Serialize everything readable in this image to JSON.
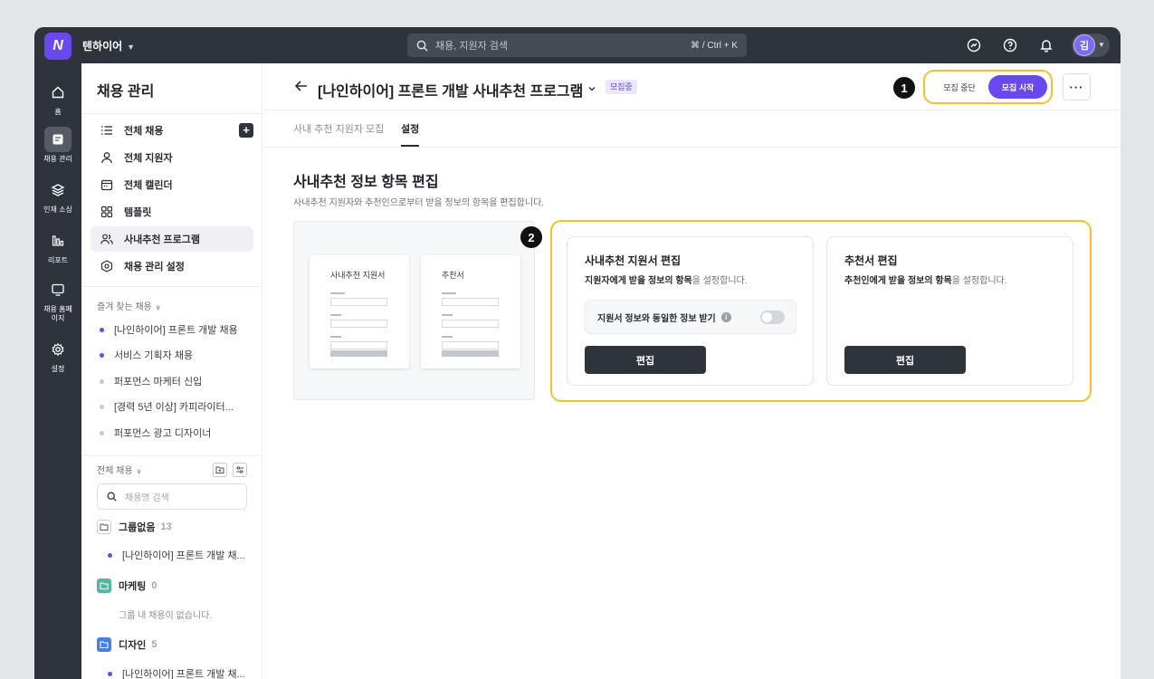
{
  "topbar": {
    "logo_letter": "N",
    "workspace": "텐하이어",
    "search_placeholder": "채용, 지원자 검색",
    "search_shortcut": "⌘ / Ctrl + K",
    "avatar_initial": "김"
  },
  "rail": {
    "items": [
      {
        "label": "홈"
      },
      {
        "label": "채용 관리"
      },
      {
        "label": "인재 소싱"
      },
      {
        "label": "리포트"
      },
      {
        "label": "채용 홈페이지"
      },
      {
        "label": "설정"
      }
    ]
  },
  "sidebar": {
    "title": "채용 관리",
    "nav": [
      {
        "label": "전체 채용"
      },
      {
        "label": "전체 지원자"
      },
      {
        "label": "전체 캘린더"
      },
      {
        "label": "템플릿"
      },
      {
        "label": "사내추천 프로그램"
      },
      {
        "label": "채용 관리 설정"
      }
    ],
    "favorites_title": "즐겨 찾는 채용",
    "favorites": [
      {
        "label": "[나인하이어] 프론트 개발 채용",
        "active": true
      },
      {
        "label": "서비스 기획자 채용",
        "active": true
      },
      {
        "label": "퍼포먼스 마케터 신입",
        "active": false
      },
      {
        "label": "[경력 5년 이상] 카피라이터...",
        "active": false
      },
      {
        "label": "퍼포먼스 광고 디자이너",
        "active": false
      }
    ],
    "all_title": "전체 채용",
    "search_placeholder": "채용명 검색",
    "groups": [
      {
        "name": "그룹없음",
        "count": "13",
        "item": "[나인하이어] 프론트 개발 채..."
      },
      {
        "name": "마케팅",
        "count": "0",
        "empty": "그룹 내 채용이 없습니다."
      },
      {
        "name": "디자인",
        "count": "5",
        "item": "[나인하이어] 프론트 개발 채..."
      }
    ]
  },
  "header": {
    "title": "[나인하이어] 프론트 개발 사내추천 프로그램",
    "badge": "모집중",
    "step1": "1",
    "stop_label": "모집 중단",
    "start_label": "모집 시작",
    "more_label": "···"
  },
  "tabs": [
    {
      "label": "사내 추천 지원자 모집"
    },
    {
      "label": "설정"
    }
  ],
  "section": {
    "title": "사내추천 정보 항목 편집",
    "desc": "사내추천 지원자와 추천인으로부터 받을 정보의 항목을 편집합니다."
  },
  "preview": {
    "left_title": "사내추천 지원서",
    "right_title": "추천서"
  },
  "step2": "2",
  "cards": [
    {
      "title": "사내추천 지원서 편집",
      "desc_bold": "지원자에게 받을 정보의 항목",
      "desc_rest": "을 설정합니다.",
      "toggle_label": "지원서 정보와 동일한 정보 받기",
      "toggle_on": false,
      "button": "편집"
    },
    {
      "title": "추천서 편집",
      "desc_bold": "추천인에게 받을 정보의 항목",
      "desc_rest": "을 설정합니다.",
      "button": "편집"
    }
  ],
  "colors": {
    "accent": "#6a48f0",
    "highlight": "#f2c12a",
    "dark": "#2f333b"
  }
}
